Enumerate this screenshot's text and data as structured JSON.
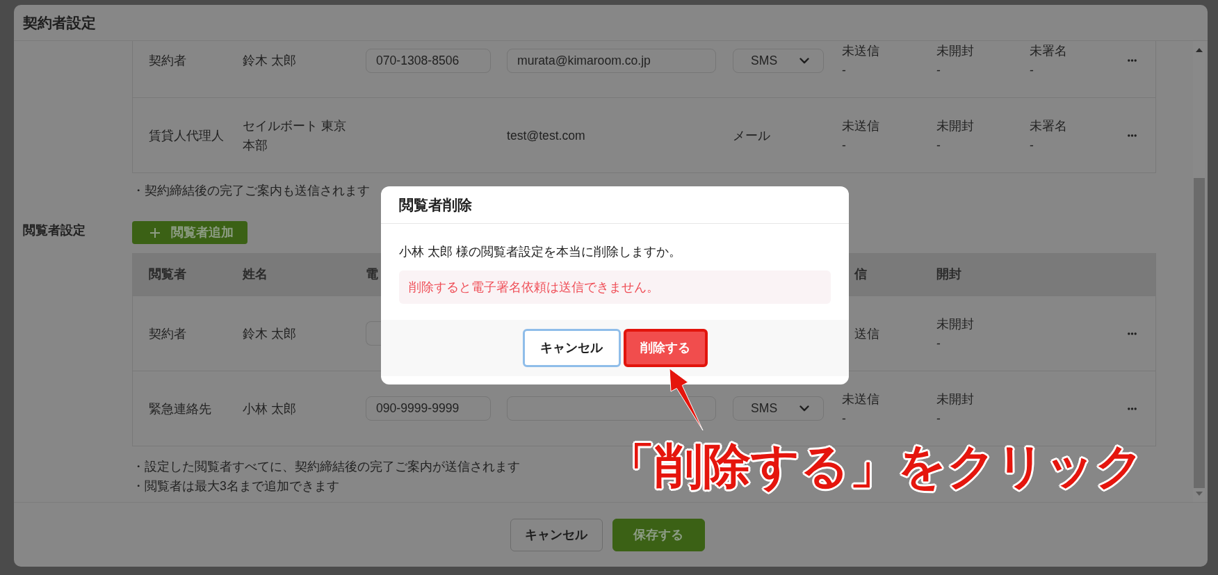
{
  "window": {
    "title": "契約者設定"
  },
  "signers": {
    "rows": [
      {
        "role": "契約者",
        "name": "鈴木 太郎",
        "phone": {
          "kind": "input",
          "value": "070-1308-8506"
        },
        "email": {
          "kind": "input",
          "value": "murata@kimaroom.co.jp"
        },
        "method": {
          "kind": "select",
          "value": "SMS"
        },
        "send": {
          "status": "未送信",
          "date": "-"
        },
        "open": {
          "status": "未開封",
          "date": "-"
        },
        "sign": {
          "status": "未署名",
          "date": "-"
        },
        "menu": true
      },
      {
        "role": "賃貸人代理人",
        "name": "セイルボート 東京本部",
        "email": {
          "kind": "text",
          "value": "test@test.com"
        },
        "method": {
          "kind": "text",
          "value": "メール"
        },
        "send": {
          "status": "未送信",
          "date": "-"
        },
        "open": {
          "status": "未開封",
          "date": "-"
        },
        "sign": {
          "status": "未署名",
          "date": "-"
        },
        "menu": true
      }
    ],
    "notes": [
      "・契約締結後の完了ご案内も送信されます"
    ]
  },
  "viewers": {
    "label": "閲覧者設定",
    "add_button": "閲覧者追加",
    "header": {
      "role": "閲覧者",
      "name": "姓名",
      "phone": "電",
      "send": {
        "text": "信",
        "covered": true
      },
      "open": "開封"
    },
    "rows": [
      {
        "role": "契約者",
        "name": "鈴木 太郎",
        "phone": {
          "kind": "input",
          "covered": true
        },
        "send": {
          "status": "送信",
          "covered": true
        },
        "open": {
          "status": "未開封",
          "date": "-"
        },
        "menu": true
      },
      {
        "role": "緊急連絡先",
        "name": "小林 太郎",
        "phone": {
          "kind": "input",
          "value": "090-9999-9999"
        },
        "email": {
          "kind": "input"
        },
        "method": {
          "kind": "select",
          "value": "SMS"
        },
        "send": {
          "status": "未送信",
          "date": "-"
        },
        "open": {
          "status": "未開封",
          "date": "-"
        },
        "menu": true
      }
    ],
    "notes": [
      "・設定した閲覧者すべてに、契約締結後の完了ご案内が送信されます",
      "・閲覧者は最大3名まで追加できます"
    ]
  },
  "footer": {
    "buttons": [
      {
        "label": "キャンセル",
        "kind": "secondary"
      },
      {
        "label": "保存する",
        "kind": "primary"
      }
    ]
  },
  "dialog": {
    "title": "閲覧者削除",
    "message": "小林 太郎 様の閲覧者設定を本当に削除しますか。",
    "warning": "削除すると電子署名依頼は送信できません。",
    "buttons": [
      {
        "label": "キャンセル",
        "kind": "secondary",
        "focused": true
      },
      {
        "label": "削除する",
        "kind": "danger",
        "highlighted": true
      }
    ]
  },
  "annotation": {
    "text": "「削除する」をクリック"
  }
}
